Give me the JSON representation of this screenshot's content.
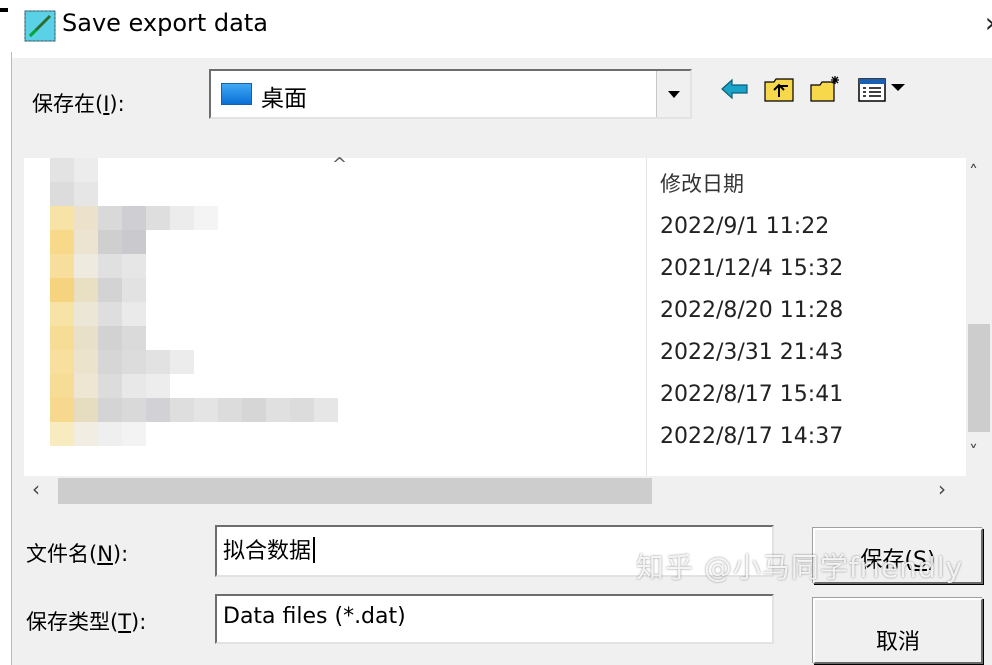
{
  "window": {
    "title": "Save export data",
    "close_glyph": "›"
  },
  "location": {
    "label_prefix": "保存在(",
    "label_key": "I",
    "label_suffix": "):",
    "value": "桌面"
  },
  "file_list": {
    "sort_caret": "^",
    "column_header": "修改日期",
    "dates": [
      "2022/9/1 11:22",
      "2021/12/4 15:32",
      "2022/8/20 11:28",
      "2022/3/31 21:43",
      "2022/8/17 15:41",
      "2022/8/17 14:37"
    ]
  },
  "scroll": {
    "up": "˄",
    "down": "˅",
    "left": "‹",
    "right": "›"
  },
  "filename": {
    "label_prefix": "文件名(",
    "label_key": "N",
    "label_suffix": "):",
    "value": "拟合数据"
  },
  "filetype": {
    "label_prefix": "保存类型(",
    "label_key": "T",
    "label_suffix": "):",
    "value": "Data files (*.dat)"
  },
  "buttons": {
    "save_prefix": "保存(",
    "save_key": "S",
    "save_suffix": ")",
    "cancel": "取消"
  },
  "watermark": "知乎 @小马同学friendly",
  "icons": {
    "app": "app-icon",
    "back": "back-arrow-icon",
    "up_folder": "up-folder-icon",
    "new_folder": "new-folder-icon",
    "view_menu": "view-menu-icon"
  },
  "colors": {
    "dialog_bg": "#f0f0f0",
    "folder_blue": "#0a6fd6",
    "back_arrow": "#1aa3c8",
    "folder_yellow": "#f7d84a"
  }
}
